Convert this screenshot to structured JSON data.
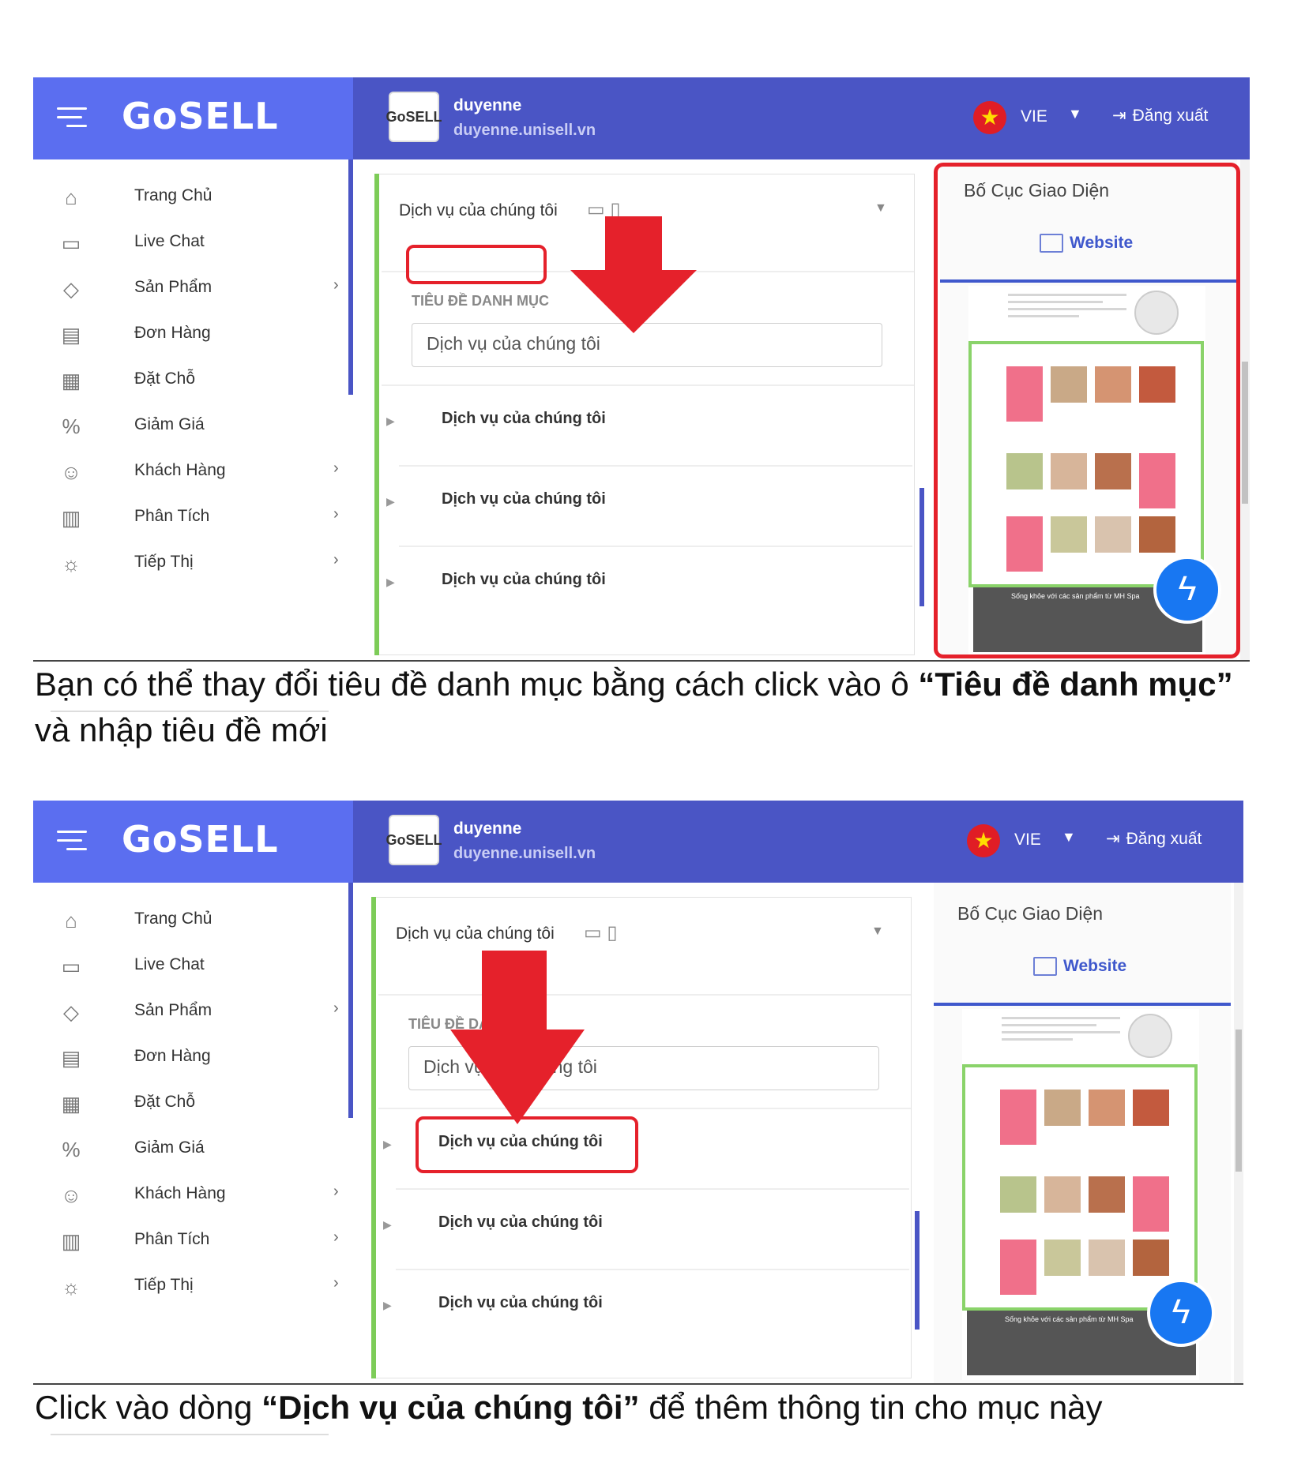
{
  "header": {
    "brand": "GoSELL",
    "store_name": "duyenne",
    "store_url": "duyenne.unisell.vn",
    "store_badge": "GoSELL",
    "language": "VIE",
    "logout": "Đăng xuất"
  },
  "sidebar": {
    "items": [
      {
        "label": "Trang Chủ",
        "icon": "home-icon",
        "has_children": false
      },
      {
        "label": "Live Chat",
        "icon": "chat-icon",
        "has_children": false
      },
      {
        "label": "Sản Phẩm",
        "icon": "tag-icon",
        "has_children": true
      },
      {
        "label": "Đơn Hàng",
        "icon": "receipt-icon",
        "has_children": false
      },
      {
        "label": "Đặt Chỗ",
        "icon": "calendar-icon",
        "has_children": false
      },
      {
        "label": "Giảm Giá",
        "icon": "percent-icon",
        "has_children": false
      },
      {
        "label": "Khách Hàng",
        "icon": "users-icon",
        "has_children": true
      },
      {
        "label": "Phân Tích",
        "icon": "chart-icon",
        "has_children": true
      },
      {
        "label": "Tiếp Thị",
        "icon": "bulb-icon",
        "has_children": true
      }
    ]
  },
  "editor": {
    "section_title": "Dịch vụ của chúng tôi",
    "field_label": "TIÊU ĐỀ DANH MỤC",
    "field_value": "Dịch vụ của chúng tôi",
    "rows": [
      "Dịch vụ của chúng tôi",
      "Dịch vụ của chúng tôi",
      "Dịch vụ của chúng tôi"
    ]
  },
  "layout_panel": {
    "title": "Bố Cục Giao Diện",
    "tab": "Website",
    "preview_footer": "Sống khỏe với các sản phẩm từ MH Spa"
  },
  "captions": {
    "first_pre": "Bạn có thể thay đổi tiêu đề danh mục bằng cách click vào ô ",
    "first_bold": "“Tiêu đề danh mục”",
    "first_post": " và nhập tiêu đề mới",
    "second_pre": "Click vào dòng ",
    "second_bold": "“Dịch vụ của chúng tôi”",
    "second_post": " để thêm thông tin cho mục này"
  },
  "colors": {
    "header": "#4a55c5",
    "logo_area": "#5b6ef0",
    "highlight": "#e5212b",
    "accent_green": "#7dcc58",
    "accent_blue": "#3f58cc"
  }
}
